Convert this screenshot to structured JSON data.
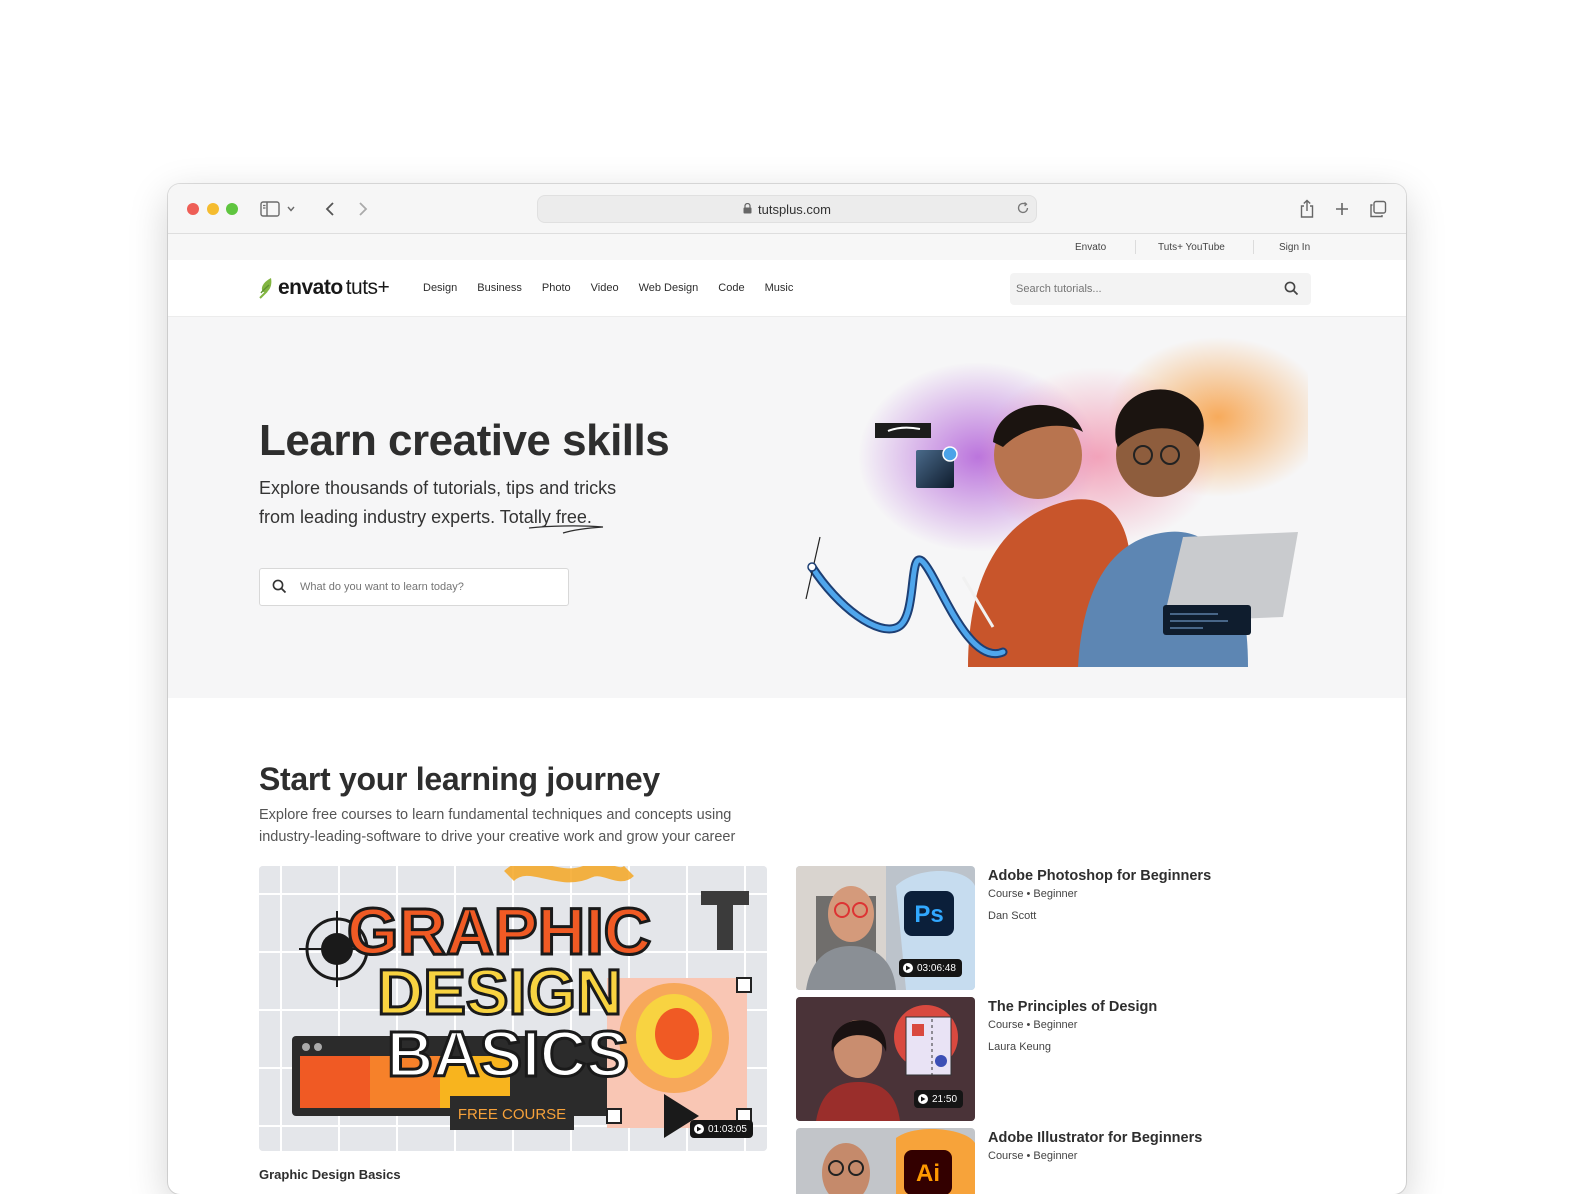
{
  "browser": {
    "url": "tutsplus.com"
  },
  "utility_bar": {
    "links": [
      "Envato",
      "Tuts+ YouTube",
      "Sign In"
    ]
  },
  "nav": {
    "logo_brand": "envato",
    "logo_product": "tuts+",
    "links": [
      "Design",
      "Business",
      "Photo",
      "Video",
      "Web Design",
      "Code",
      "Music"
    ],
    "search_placeholder": "Search tutorials..."
  },
  "hero": {
    "title": "Learn creative skills",
    "subtitle_line1": "Explore thousands of tutorials, tips and tricks",
    "subtitle_line2": "from leading industry experts.",
    "subtitle_emphasis": "Totally free.",
    "search_placeholder": "What do you want to learn today?"
  },
  "journey": {
    "title": "Start your learning journey",
    "description": "Explore free courses to learn fundamental techniques and concepts using industry-leading-software to drive your creative work and grow your career",
    "featured": {
      "thumb_line1": "GRAPHIC",
      "thumb_line2": "DESIGN",
      "thumb_line3": "BASICS",
      "badge": "FREE COURSE",
      "duration": "01:03:05",
      "caption": "Graphic Design Basics"
    },
    "courses": [
      {
        "title": "Adobe Photoshop for Beginners",
        "meta": "Course • Beginner",
        "author": "Dan Scott",
        "duration": "03:06:48",
        "app_icon": "Ps"
      },
      {
        "title": "The Principles of Design",
        "meta": "Course • Beginner",
        "author": "Laura Keung",
        "duration": "21:50",
        "app_icon": ""
      },
      {
        "title": "Adobe Illustrator for Beginners",
        "meta": "Course • Beginner",
        "author": "",
        "duration": "",
        "app_icon": "Ai"
      }
    ]
  },
  "colors": {
    "logo_green": "#82b541",
    "hero_bg": "#f6f6f7",
    "accent_orange": "#f05a24"
  }
}
